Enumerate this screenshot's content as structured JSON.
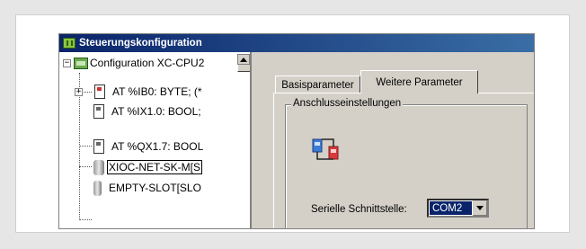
{
  "window": {
    "title": "Steuerungskonfiguration",
    "title_icon": "configuration-app-icon"
  },
  "tree": {
    "root": {
      "label": "Configuration XC-CPU2",
      "icon": "configuration-icon",
      "expander": "−"
    },
    "items": [
      {
        "label": "AT %IB0: BYTE; (*",
        "icon": "digital-input-icon",
        "expander": "+"
      },
      {
        "label": "AT %IX1.0: BOOL;",
        "icon": "digital-input-bit-icon"
      },
      {
        "label": "AT %QX1.7: BOOL",
        "icon": "digital-output-bit-icon"
      },
      {
        "label": "XIOC-NET-SK-M[S",
        "icon": "module-icon",
        "selected": true
      },
      {
        "label": "EMPTY-SLOT[SLO",
        "icon": "empty-slot-icon"
      }
    ]
  },
  "tabs": [
    {
      "label": "Basisparameter",
      "active": false
    },
    {
      "label": "Weitere Parameter",
      "active": true
    }
  ],
  "group": {
    "legend": "Anschlusseinstellungen",
    "icon": "serial-connection-icon"
  },
  "serial": {
    "label": "Serielle Schnittstelle:",
    "selected_value": "COM2"
  },
  "colors": {
    "titlebar_start": "#0a246a",
    "titlebar_end": "#3a6ea5",
    "selection": "#0a246a",
    "face": "#d4d0c8"
  }
}
